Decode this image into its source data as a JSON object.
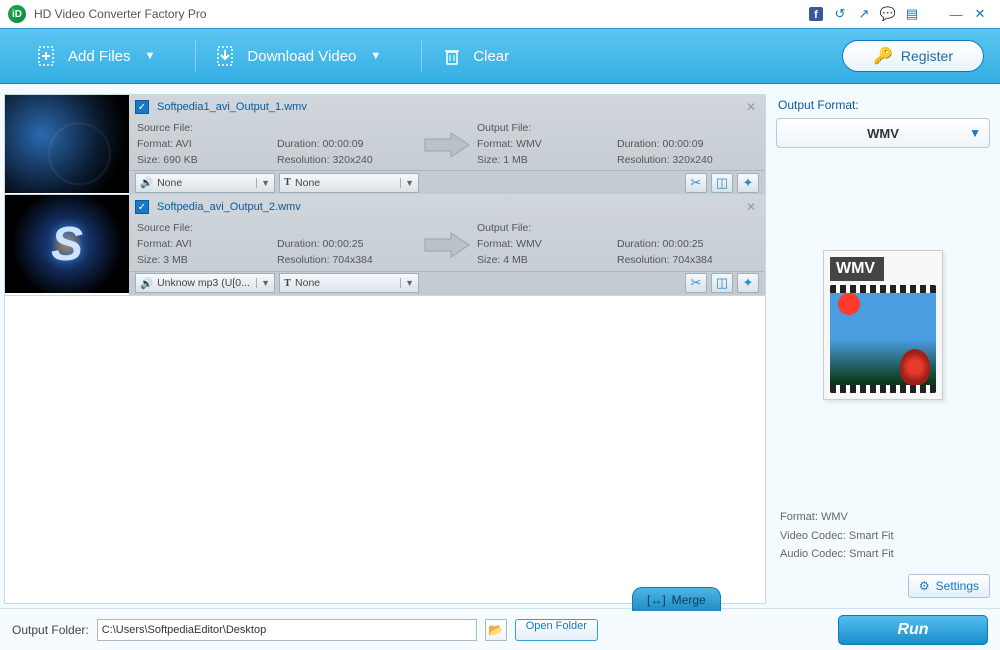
{
  "app": {
    "title": "HD Video Converter Factory Pro"
  },
  "toolbar": {
    "add_files": "Add Files",
    "download_video": "Download Video",
    "clear": "Clear",
    "register": "Register"
  },
  "files": [
    {
      "name": "Softpedia1_avi_Output_1.wmv",
      "source_label": "Source File:",
      "output_label": "Output File:",
      "src_format_label": "Format:",
      "src_format": "AVI",
      "src_duration_label": "Duration:",
      "src_duration": "00:00:09",
      "src_size_label": "Size:",
      "src_size": "690 KB",
      "src_res_label": "Resolution:",
      "src_res": "320x240",
      "out_format_label": "Format:",
      "out_format": "WMV",
      "out_duration_label": "Duration:",
      "out_duration": "00:00:09",
      "out_size_label": "Size:",
      "out_size": "1 MB",
      "out_res_label": "Resolution:",
      "out_res": "320x240",
      "audio": "None",
      "subtitle": "None"
    },
    {
      "name": "Softpedia_avi_Output_2.wmv",
      "source_label": "Source File:",
      "output_label": "Output File:",
      "src_format_label": "Format:",
      "src_format": "AVI",
      "src_duration_label": "Duration:",
      "src_duration": "00:00:25",
      "src_size_label": "Size:",
      "src_size": "3 MB",
      "src_res_label": "Resolution:",
      "src_res": "704x384",
      "out_format_label": "Format:",
      "out_format": "WMV",
      "out_duration_label": "Duration:",
      "out_duration": "00:00:25",
      "out_size_label": "Size:",
      "out_size": "4 MB",
      "out_res_label": "Resolution:",
      "out_res": "704x384",
      "audio": "Unknow mp3 (U[0...",
      "subtitle": "None"
    }
  ],
  "side": {
    "title": "Output Format:",
    "format": "WMV",
    "badge": "WMV",
    "info_format_label": "Format:",
    "info_format": "WMV",
    "info_vcodec_label": "Video Codec:",
    "info_vcodec": "Smart Fit",
    "info_acodec_label": "Audio Codec:",
    "info_acodec": "Smart Fit",
    "settings": "Settings"
  },
  "bottom": {
    "merge": "Merge",
    "output_folder_label": "Output Folder:",
    "output_folder": "C:\\Users\\SoftpediaEditor\\Desktop",
    "open_folder": "Open Folder",
    "run": "Run"
  }
}
